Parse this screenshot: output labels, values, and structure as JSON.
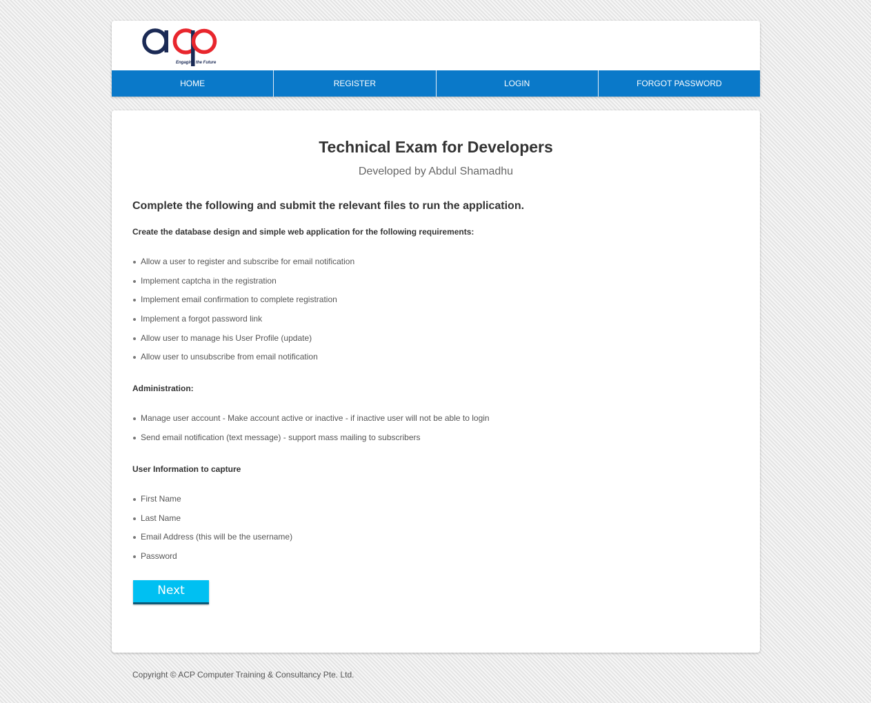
{
  "header": {
    "logo_text": "acp",
    "tagline": "Engaging the Future"
  },
  "nav": {
    "items": [
      {
        "label": "HOME"
      },
      {
        "label": "REGISTER"
      },
      {
        "label": "LOGIN"
      },
      {
        "label": "FORGOT PASSWORD"
      }
    ]
  },
  "main": {
    "title": "Technical Exam for Developers",
    "subtitle": "Developed by Abdul Shamadhu",
    "intro": "Complete the following and submit the relevant files to run the application.",
    "requirements_heading": "Create the database design and simple web application for the following requirements:",
    "requirements": [
      "Allow a user to register and subscribe for email notification",
      "Implement captcha in the registration",
      "Implement email confirmation to complete registration",
      "Implement a forgot password link",
      "Allow user to manage his User Profile (update)",
      "Allow user to unsubscribe from email notification"
    ],
    "admin_heading": "Administration:",
    "admin_items": [
      "Manage user account - Make account active or inactive - if inactive user will not be able to login",
      "Send email notification (text message) - support mass mailing to subscribers"
    ],
    "user_info_heading": "User Information to capture",
    "user_info_items": [
      "First Name",
      "Last Name",
      "Email Address (this will be the username)",
      "Password"
    ],
    "next_button": "Next"
  },
  "footer": {
    "copyright": "Copyright © ACP Computer Training & Consultancy Pte. Ltd."
  },
  "colors": {
    "nav_blue": "#0a79c9",
    "logo_navy": "#1b2a55",
    "logo_red": "#e8262d",
    "button_cyan": "#00c0f2"
  }
}
